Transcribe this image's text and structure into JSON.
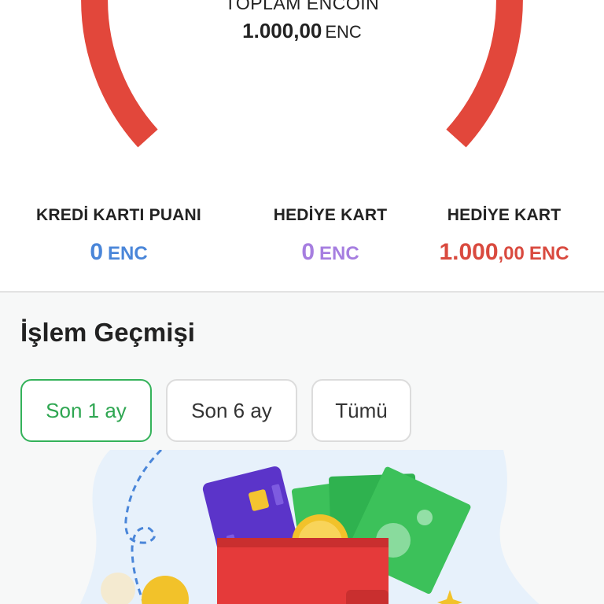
{
  "total": {
    "label": "TOPLAM ENCOIN",
    "amount": "1.000,00",
    "unit": "ENC"
  },
  "stats": [
    {
      "label": "KREDİ KARTI PUANI",
      "amount": "0",
      "unit": "ENC",
      "color": "#4a86d9"
    },
    {
      "label": "HEDİYE KART",
      "amount": "0",
      "unit": "ENC",
      "color": "#a67ee0"
    },
    {
      "label": "HEDİYE KART",
      "amount_int": "1.000",
      "amount_dec": ",00",
      "unit": "ENC",
      "color": "#d94a3f"
    }
  ],
  "history": {
    "title": "İşlem Geçmişi",
    "filters": [
      "Son 1 ay",
      "Son 6 ay",
      "Tümü"
    ],
    "selected_filter": "Son 1 ay"
  },
  "colors": {
    "gauge_arc": "#e2473b",
    "selected_filter": "#34b25a",
    "card": "#5b34c9",
    "wallet": "#e53a3a",
    "cash": "#3cc15a",
    "coin": "#f2c22a"
  },
  "illustration": {
    "icons": [
      "wallet-icon",
      "credit-card-icon",
      "banknotes-icon",
      "coin-icon"
    ]
  }
}
